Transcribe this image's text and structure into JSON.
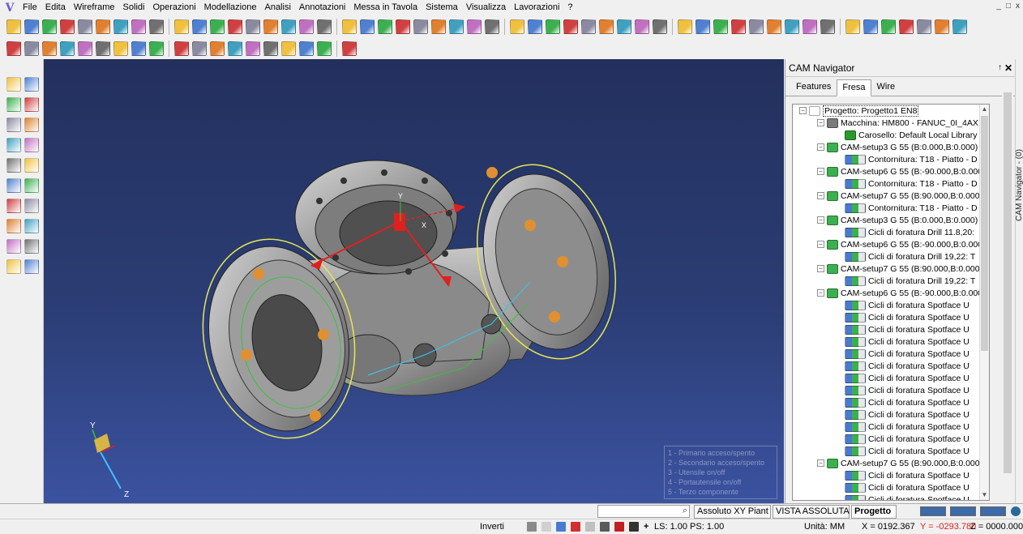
{
  "menu": {
    "items": [
      "File",
      "Edita",
      "Wireframe",
      "Solidi",
      "Operazioni",
      "Modellazione",
      "Analisi",
      "Annotazioni",
      "Messa in Tavola",
      "Sistema",
      "Visualizza",
      "Lavorazioni",
      "?"
    ]
  },
  "window_controls": [
    "_",
    "□",
    "x"
  ],
  "viewport": {
    "background_colors": [
      "#23305e",
      "#3b52a0"
    ],
    "axis_labels": {
      "y": "Y",
      "z": "Z",
      "x": "X"
    },
    "model_axis_labels": {
      "y": "Y",
      "x": "X"
    },
    "legend": [
      "1 - Primario acceso/spento",
      "2 - Secondario acceso/spento",
      "3 - Utensile on/off",
      "4 - Portautensile on/off",
      "5 - Terzo componente"
    ]
  },
  "cam_navigator": {
    "title": "CAM Navigator",
    "pin": "↑",
    "close": "✕",
    "tabs": [
      "Features",
      "Fresa",
      "Wire"
    ],
    "active_tab": "Fresa",
    "side_label": "CAM Navigator - (0)",
    "tree": [
      {
        "level": 0,
        "exp": "−",
        "icon": "document",
        "text": "Progetto: Progetto1 EN8"
      },
      {
        "level": 1,
        "exp": "−",
        "icon": "machine",
        "text": "Macchina: HM800 - FANUC_0I_4AX"
      },
      {
        "level": 2,
        "exp": "",
        "icon": "library",
        "text": "Carosello: Default Local Library"
      },
      {
        "level": 1,
        "exp": "−",
        "icon": "setup",
        "text": "CAM-setup3 G 55 (B:0.000,B:0.000)"
      },
      {
        "level": 2,
        "exp": "",
        "icon": "op",
        "text": "Contornitura: T18 - Piatto - D"
      },
      {
        "level": 1,
        "exp": "−",
        "icon": "setup",
        "text": "CAM-setup6 G 55 (B:-90.000,B:0.000"
      },
      {
        "level": 2,
        "exp": "",
        "icon": "op",
        "text": "Contornitura: T18 - Piatto - D"
      },
      {
        "level": 1,
        "exp": "−",
        "icon": "setup",
        "text": "CAM-setup7 G 55 (B:90.000,B:0.000"
      },
      {
        "level": 2,
        "exp": "",
        "icon": "op",
        "text": "Contornitura: T18 - Piatto - D"
      },
      {
        "level": 1,
        "exp": "−",
        "icon": "setup",
        "text": "CAM-setup3 G 55 (B:0.000,B:0.000)"
      },
      {
        "level": 2,
        "exp": "",
        "icon": "op",
        "text": "Cicli di foratura Drill 11.8,20:"
      },
      {
        "level": 1,
        "exp": "−",
        "icon": "setup",
        "text": "CAM-setup6 G 55 (B:-90.000,B:0.000"
      },
      {
        "level": 2,
        "exp": "",
        "icon": "op",
        "text": "Cicli di foratura Drill 19,22: T"
      },
      {
        "level": 1,
        "exp": "−",
        "icon": "setup",
        "text": "CAM-setup7 G 55 (B:90.000,B:0.000"
      },
      {
        "level": 2,
        "exp": "",
        "icon": "op",
        "text": "Cicli di foratura Drill 19,22: T"
      },
      {
        "level": 1,
        "exp": "−",
        "icon": "setup",
        "text": "CAM-setup6 G 55 (B:-90.000,B:0.000"
      },
      {
        "level": 2,
        "exp": "",
        "icon": "op",
        "text": "Cicli di foratura Spotface U"
      },
      {
        "level": 2,
        "exp": "",
        "icon": "op",
        "text": "Cicli di foratura Spotface U"
      },
      {
        "level": 2,
        "exp": "",
        "icon": "op",
        "text": "Cicli di foratura Spotface U"
      },
      {
        "level": 2,
        "exp": "",
        "icon": "op",
        "text": "Cicli di foratura Spotface U"
      },
      {
        "level": 2,
        "exp": "",
        "icon": "op",
        "text": "Cicli di foratura Spotface U"
      },
      {
        "level": 2,
        "exp": "",
        "icon": "op",
        "text": "Cicli di foratura Spotface U"
      },
      {
        "level": 2,
        "exp": "",
        "icon": "op",
        "text": "Cicli di foratura Spotface U"
      },
      {
        "level": 2,
        "exp": "",
        "icon": "op",
        "text": "Cicli di foratura Spotface U"
      },
      {
        "level": 2,
        "exp": "",
        "icon": "op",
        "text": "Cicli di foratura Spotface U"
      },
      {
        "level": 2,
        "exp": "",
        "icon": "op",
        "text": "Cicli di foratura Spotface U"
      },
      {
        "level": 2,
        "exp": "",
        "icon": "op",
        "text": "Cicli di foratura Spotface U"
      },
      {
        "level": 2,
        "exp": "",
        "icon": "op",
        "text": "Cicli di foratura Spotface U"
      },
      {
        "level": 2,
        "exp": "",
        "icon": "op",
        "text": "Cicli di foratura Spotface U"
      },
      {
        "level": 1,
        "exp": "−",
        "icon": "setup",
        "text": "CAM-setup7 G 55 (B:90.000,B:0.000"
      },
      {
        "level": 2,
        "exp": "",
        "icon": "op",
        "text": "Cicli di foratura Spotface U"
      },
      {
        "level": 2,
        "exp": "",
        "icon": "op",
        "text": "Cicli di foratura Spotface U"
      },
      {
        "level": 2,
        "exp": "",
        "icon": "op",
        "text": "Cicli di foratura Spotface U"
      },
      {
        "level": 2,
        "exp": "",
        "icon": "op",
        "text": "Cicli di foratura Spotface U"
      }
    ]
  },
  "status_top": {
    "command_input": "",
    "search_icon": "⌕",
    "plane": "Assoluto XY Piant",
    "view": "VISTA ASSOLUTA",
    "project_tab": "Progetto"
  },
  "status_bottom": {
    "invert_label": "Inverti",
    "ls_ps": "LS: 1.00 PS: 1.00",
    "units": "Unità: MM",
    "x": "X = 0192.367",
    "y": "Y = -0293.780",
    "z": "Z = 0000.000"
  },
  "colors": {
    "accent_red": "#e02020",
    "model_gray": "#9a9a9a",
    "toolpath_yellow": "#e8e850",
    "toolpath_green": "#3cc03c",
    "hole_orange": "#e09030"
  },
  "toolbar_icons": [
    "new",
    "open",
    "save",
    "print",
    "zoom",
    "fit",
    "rotate",
    "select",
    "line",
    "arc",
    "circle",
    "solid",
    "extrude",
    "measure",
    "setup",
    "tool",
    "holder",
    "stock"
  ]
}
